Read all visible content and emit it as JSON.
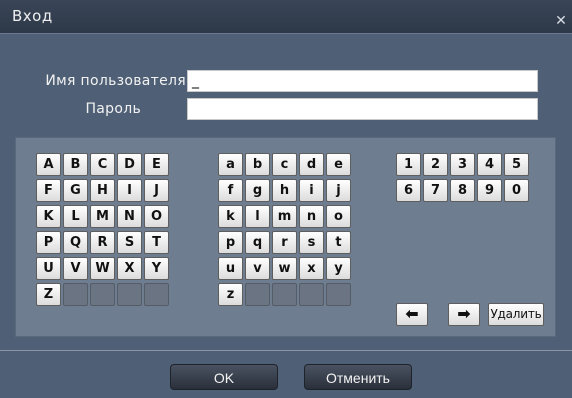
{
  "window": {
    "title": "Вход",
    "close_glyph": "✕"
  },
  "form": {
    "username_label": "Имя пользователя",
    "username_value": "_",
    "password_label": "Пароль",
    "password_value": ""
  },
  "keyboard": {
    "upper": [
      "A",
      "B",
      "C",
      "D",
      "E",
      "F",
      "G",
      "H",
      "I",
      "J",
      "K",
      "L",
      "M",
      "N",
      "O",
      "P",
      "Q",
      "R",
      "S",
      "T",
      "U",
      "V",
      "W",
      "X",
      "Y",
      "Z"
    ],
    "lower": [
      "a",
      "b",
      "c",
      "d",
      "e",
      "f",
      "g",
      "h",
      "i",
      "j",
      "k",
      "l",
      "m",
      "n",
      "o",
      "p",
      "q",
      "r",
      "s",
      "t",
      "u",
      "v",
      "w",
      "x",
      "y",
      "z"
    ],
    "digits": [
      "1",
      "2",
      "3",
      "4",
      "5",
      "6",
      "7",
      "8",
      "9",
      "0"
    ],
    "left_arrow": "⬅",
    "right_arrow": "➡",
    "delete_label": "Удалить"
  },
  "buttons": {
    "ok": "OK",
    "cancel": "Отменить"
  }
}
